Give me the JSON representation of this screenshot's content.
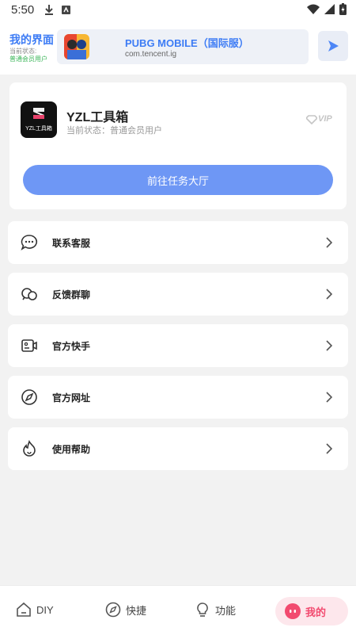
{
  "status_bar": {
    "time": "5:50"
  },
  "header": {
    "title": "我的界面",
    "status_label": "当前状态:",
    "status_value": "普通会员用户",
    "app": {
      "name": "PUBG MOBILE（国际服）",
      "package": "com.tencent.ig"
    }
  },
  "profile": {
    "logo_text": "YZL工具箱",
    "name": "YZL工具箱",
    "status": "当前状态：普通会员用户",
    "badge": "VIP",
    "task_button": "前往任务大厅"
  },
  "menu": [
    {
      "label": "联系客服",
      "icon": "chat-bubble-icon"
    },
    {
      "label": "反馈群聊",
      "icon": "group-chat-icon"
    },
    {
      "label": "官方快手",
      "icon": "video-card-icon"
    },
    {
      "label": "官方网址",
      "icon": "compass-icon"
    },
    {
      "label": "使用帮助",
      "icon": "flame-help-icon"
    }
  ],
  "bottom_nav": [
    {
      "label": "DIY",
      "icon": "home-icon"
    },
    {
      "label": "快捷",
      "icon": "compass-icon"
    },
    {
      "label": "功能",
      "icon": "lightbulb-icon"
    },
    {
      "label": "我的",
      "icon": "profile-dot-icon",
      "active": true
    }
  ],
  "colors": {
    "accent": "#3d7cf5",
    "button": "#6e97f5",
    "active": "#f24a6f",
    "active_bg": "#fde7ec"
  }
}
